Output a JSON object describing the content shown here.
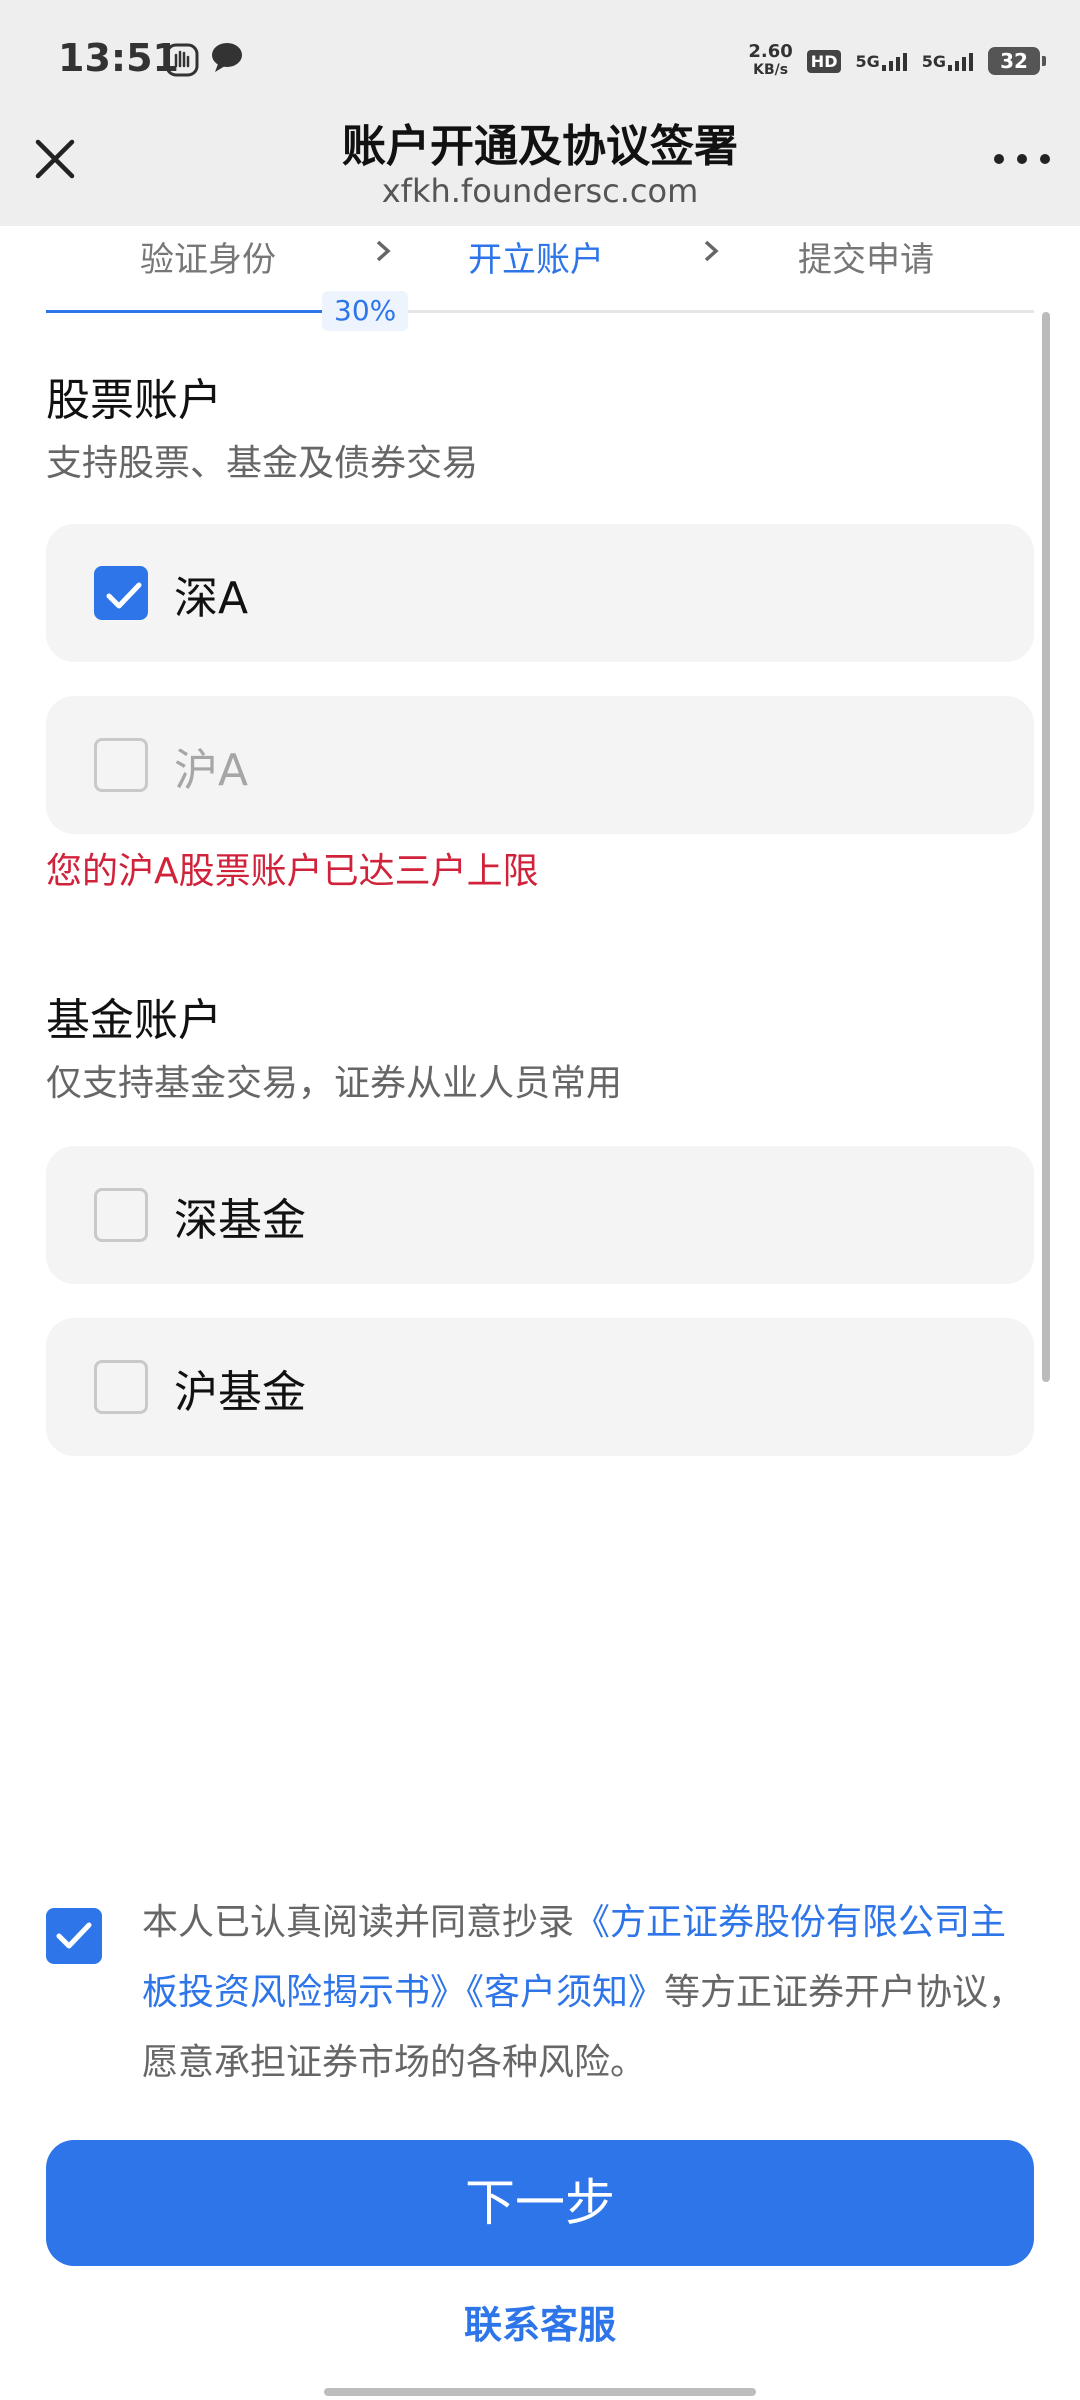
{
  "status_bar": {
    "time": "13:51",
    "net_speed_value": "2.60",
    "net_speed_unit": "KB/s",
    "hd_label": "HD",
    "sim1": "5G",
    "sim2": "5G",
    "battery": "32"
  },
  "header": {
    "title": "账户开通及协议签署",
    "url": "xfkh.foundersc.com"
  },
  "steps": [
    {
      "label": "验证身份"
    },
    {
      "label": "开立账户"
    },
    {
      "label": "提交申请"
    }
  ],
  "progress": {
    "label": "30%",
    "value": 0.3
  },
  "stock_section": {
    "title": "股票账户",
    "desc": "支持股票、基金及债券交易",
    "options": [
      {
        "label": "深A",
        "checked": true,
        "disabled": false
      },
      {
        "label": "沪A",
        "checked": false,
        "disabled": true
      }
    ],
    "error": "您的沪A股票账户已达三户上限"
  },
  "fund_section": {
    "title": "基金账户",
    "desc": "仅支持基金交易，证券从业人员常用",
    "options": [
      {
        "label": "深基金",
        "checked": false
      },
      {
        "label": "沪基金",
        "checked": false
      }
    ]
  },
  "agreement": {
    "checked": true,
    "prefix": "本人已认真阅读并同意抄录",
    "link1": "《方正证券股份有限公司主板投资风险揭示书》",
    "link2": "《客户须知》",
    "suffix": "等方正证券开户协议，愿意承担证券市场的各种风险。"
  },
  "next_button": "下一步",
  "service_link": "联系客服",
  "colors": {
    "accent": "#2d75e8",
    "error": "#d0233b"
  }
}
